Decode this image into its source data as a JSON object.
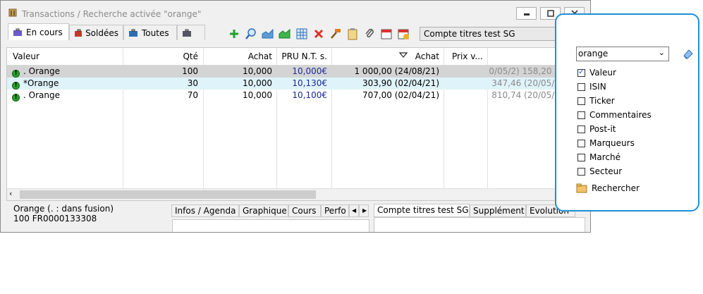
{
  "window": {
    "title": "Transactions / Recherche activée \"orange\""
  },
  "tabs": [
    {
      "label": "En cours",
      "icon": "briefcase-icon",
      "active": true
    },
    {
      "label": "Soldées",
      "icon": "briefcase-red-icon",
      "active": false
    },
    {
      "label": "Toutes",
      "icon": "briefcase-blue-icon",
      "active": false
    },
    {
      "label": "",
      "icon": "briefcase-icon",
      "active": false
    }
  ],
  "toolbar": {
    "icons": [
      "plus-icon",
      "zoom-icon",
      "chart-blue-icon",
      "chart-green-icon",
      "table-icon",
      "delete-icon",
      "hammer-icon",
      "clipboard-icon",
      "paperclip-icon",
      "calendar-icon",
      "calendar-alert-icon"
    ],
    "account_value": "Compte titres test SG"
  },
  "grid": {
    "headers": {
      "valeur": "Valeur",
      "qte": "Qté",
      "achat": "Achat",
      "pru": "PRU N.T. s.",
      "achat2": "Achat",
      "prix": "Prix v..."
    },
    "rows": [
      {
        "valeur": ". Orange",
        "qte": "100",
        "achat": "10,000",
        "pru": "10,000€",
        "achat_date": "1 000,00 (24/08/21)",
        "prix": "1 158,20 (20/05/2"
      },
      {
        "valeur": "*Orange",
        "qte": "30",
        "achat": "10,000",
        "pru": "10,130€",
        "achat_date": "303,90 (02/04/21)",
        "prix": "347,46 (20/05/2"
      },
      {
        "valeur": ". Orange",
        "qte": "70",
        "achat": "10,000",
        "pru": "10,100€",
        "achat_date": "707,00 (02/04/21)",
        "prix": "810,74 (20/05/2"
      }
    ]
  },
  "bottom": {
    "info_line1": "Orange (. : dans fusion)",
    "info_line2": "100 FR0000133308",
    "tabs_left": [
      "Infos / Agenda",
      "Graphique",
      "Cours",
      "Perfo"
    ],
    "tabs_right": [
      "Compte titres test SG",
      "Supplément",
      "Evolution"
    ]
  },
  "search_panel": {
    "value": "orange",
    "options": [
      {
        "label": "Valeur",
        "checked": true
      },
      {
        "label": "ISIN",
        "checked": false
      },
      {
        "label": "Ticker",
        "checked": false
      },
      {
        "label": "Commentaires",
        "checked": false
      },
      {
        "label": "Post-it",
        "checked": false
      },
      {
        "label": "Marqueurs",
        "checked": false
      },
      {
        "label": "Marché",
        "checked": false
      },
      {
        "label": "Secteur",
        "checked": false
      }
    ],
    "search_button": "Rechercher"
  },
  "colors": {
    "accent": "#1e8fd8",
    "pru_text": "#1a2a9a",
    "row_selected": "#d4d4d4",
    "row_highlight": "#dff3fb",
    "muted": "#8a8a8a"
  }
}
